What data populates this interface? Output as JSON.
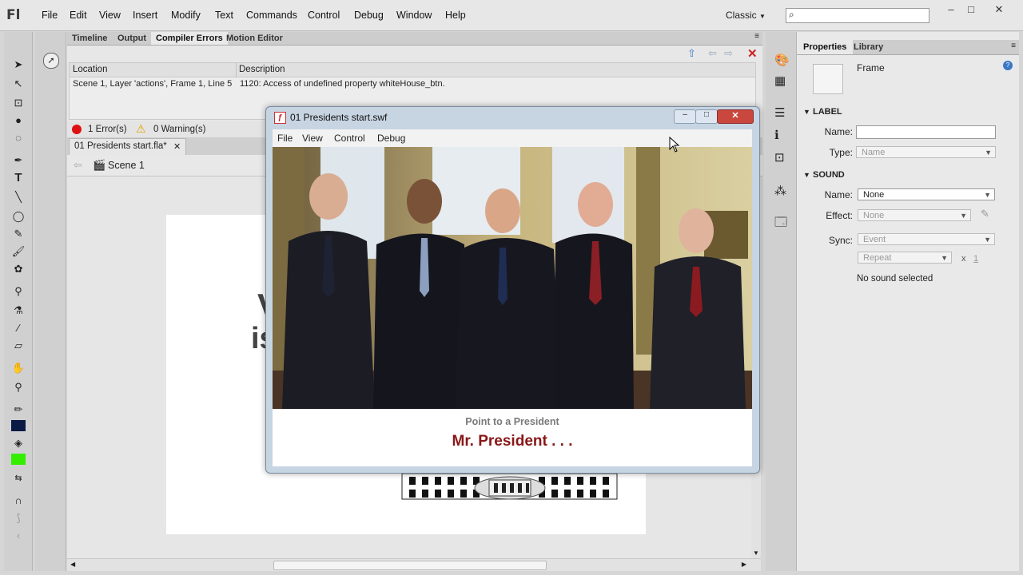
{
  "app": {
    "logo": "Fl"
  },
  "menubar": {
    "items": [
      "File",
      "Edit",
      "View",
      "Insert",
      "Modify",
      "Text",
      "Commands",
      "Control",
      "Debug",
      "Window",
      "Help"
    ],
    "workspace": "Classic"
  },
  "panel_tabs": [
    "Timeline",
    "Output",
    "Compiler Errors",
    "Motion Editor"
  ],
  "errors": {
    "columns": [
      "Location",
      "Description"
    ],
    "rows": [
      {
        "location": "Scene 1, Layer 'actions', Frame 1, Line 5",
        "description": "1120: Access of undefined property whiteHouse_btn."
      }
    ],
    "error_count": "1 Error(s)",
    "warning_count": "0 Warning(s)"
  },
  "document": {
    "tab_label": "01 Presidents start.fla*",
    "scene": "Scene 1",
    "stage_fragment_1": "V",
    "stage_fragment_2": "is"
  },
  "swf": {
    "title": "01 Presidents start.swf",
    "menu": [
      "File",
      "View",
      "Control",
      "Debug"
    ],
    "prompt": "Point to a President",
    "headline": "Mr. President . . ."
  },
  "properties": {
    "tabs": [
      "Properties",
      "Library"
    ],
    "object_type": "Frame",
    "label_section": "LABEL",
    "name_label": "Name:",
    "type_label": "Type:",
    "type_value": "Name",
    "sound_section": "SOUND",
    "sound_name_label": "Name:",
    "sound_name_value": "None",
    "effect_label": "Effect:",
    "effect_value": "None",
    "sync_label": "Sync:",
    "sync_value": "Event",
    "repeat_value": "Repeat",
    "repeat_x": "x",
    "repeat_count": "1",
    "no_sound": "No sound selected"
  },
  "colors": {
    "headline": "#8a1717",
    "stroke_color": "#0a1a45",
    "fill_color": "#33ee00"
  }
}
